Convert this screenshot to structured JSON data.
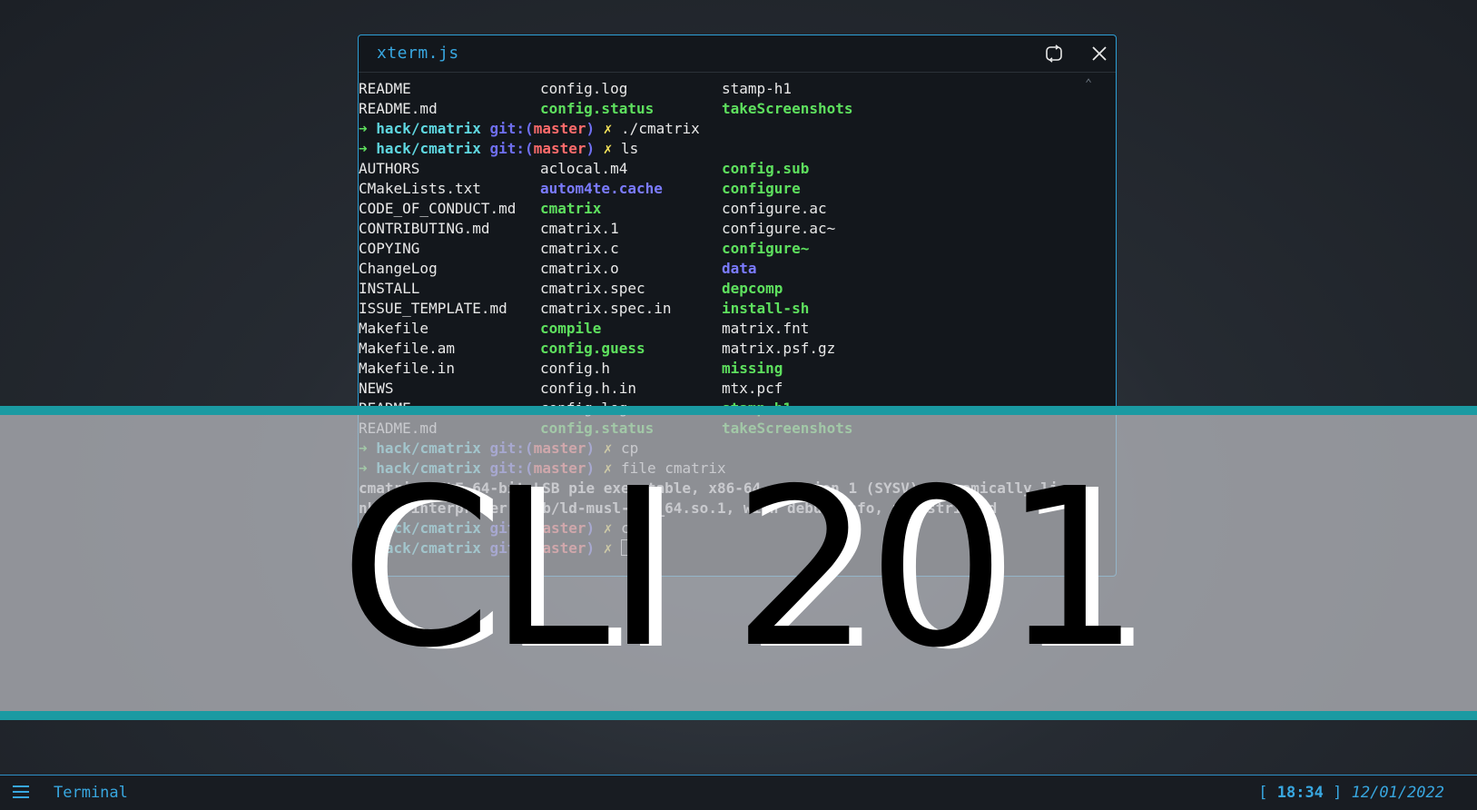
{
  "window": {
    "title": "xterm.js",
    "icons": {
      "refresh": "refresh-icon",
      "close": "close-icon",
      "scroll": "chevron-up-icon"
    },
    "scroll_glyph": "⌃"
  },
  "terminal": {
    "listing_top": [
      [
        {
          "t": "README",
          "s": ""
        },
        {
          "t": "config.log",
          "s": ""
        },
        {
          "t": "stamp-h1",
          "s": ""
        }
      ],
      [
        {
          "t": "README.md",
          "s": ""
        },
        {
          "t": "config.status",
          "s": "green"
        },
        {
          "t": "takeScreenshots",
          "s": "green"
        }
      ]
    ],
    "prompts_top": [
      {
        "arrow": "➜",
        "path": "hack/cmatrix",
        "git": "git:(",
        "branch": "master",
        "close": ")",
        "dirty": "✗",
        "cmd": "./cmatrix"
      },
      {
        "arrow": "➜",
        "path": "hack/cmatrix",
        "git": "git:(",
        "branch": "master",
        "close": ")",
        "dirty": "✗",
        "cmd": "ls"
      }
    ],
    "listing": [
      [
        {
          "t": "AUTHORS",
          "s": ""
        },
        {
          "t": "aclocal.m4",
          "s": ""
        },
        {
          "t": "config.sub",
          "s": "green"
        }
      ],
      [
        {
          "t": "CMakeLists.txt",
          "s": ""
        },
        {
          "t": "autom4te.cache",
          "s": "blue"
        },
        {
          "t": "configure",
          "s": "green"
        }
      ],
      [
        {
          "t": "CODE_OF_CONDUCT.md",
          "s": ""
        },
        {
          "t": "cmatrix",
          "s": "green"
        },
        {
          "t": "configure.ac",
          "s": ""
        }
      ],
      [
        {
          "t": "CONTRIBUTING.md",
          "s": ""
        },
        {
          "t": "cmatrix.1",
          "s": ""
        },
        {
          "t": "configure.ac~",
          "s": ""
        }
      ],
      [
        {
          "t": "COPYING",
          "s": ""
        },
        {
          "t": "cmatrix.c",
          "s": ""
        },
        {
          "t": "configure~",
          "s": "green"
        }
      ],
      [
        {
          "t": "ChangeLog",
          "s": ""
        },
        {
          "t": "cmatrix.o",
          "s": ""
        },
        {
          "t": "data",
          "s": "blue"
        }
      ],
      [
        {
          "t": "INSTALL",
          "s": ""
        },
        {
          "t": "cmatrix.spec",
          "s": ""
        },
        {
          "t": "depcomp",
          "s": "green"
        }
      ],
      [
        {
          "t": "ISSUE_TEMPLATE.md",
          "s": ""
        },
        {
          "t": "cmatrix.spec.in",
          "s": ""
        },
        {
          "t": "install-sh",
          "s": "green"
        }
      ],
      [
        {
          "t": "Makefile",
          "s": ""
        },
        {
          "t": "compile",
          "s": "green"
        },
        {
          "t": "matrix.fnt",
          "s": ""
        }
      ],
      [
        {
          "t": "Makefile.am",
          "s": ""
        },
        {
          "t": "config.guess",
          "s": "green"
        },
        {
          "t": "matrix.psf.gz",
          "s": ""
        }
      ],
      [
        {
          "t": "Makefile.in",
          "s": ""
        },
        {
          "t": "config.h",
          "s": ""
        },
        {
          "t": "missing",
          "s": "green"
        }
      ],
      [
        {
          "t": "NEWS",
          "s": ""
        },
        {
          "t": "config.h.in",
          "s": ""
        },
        {
          "t": "mtx.pcf",
          "s": ""
        }
      ],
      [
        {
          "t": "README",
          "s": ""
        },
        {
          "t": "config.log",
          "s": ""
        },
        {
          "t": "stamp-h1",
          "s": "green"
        }
      ],
      [
        {
          "t": "README.md",
          "s": ""
        },
        {
          "t": "config.status",
          "s": "green"
        },
        {
          "t": "takeScreenshots",
          "s": "green"
        }
      ]
    ],
    "prompts_mid": [
      {
        "arrow": "➜",
        "path": "hack/cmatrix",
        "git": "git:(",
        "branch": "master",
        "close": ")",
        "dirty": "✗",
        "cmd": "cp"
      },
      {
        "arrow": "➜",
        "path": "hack/cmatrix",
        "git": "git:(",
        "branch": "master",
        "close": ")",
        "dirty": "✗",
        "cmd": "file cmatrix"
      }
    ],
    "output_lines": [
      "cmatrix: ELF 64-bit LSB pie executable, x86-64, version 1 (SYSV), dynamically li",
      "nked, interpreter /lib/ld-musl-x86_64.so.1, with debug_info, not stripped"
    ],
    "prompts_bottom": [
      {
        "arrow": "➜",
        "path": "hack/cmatrix",
        "git": "git:(",
        "branch": "master",
        "close": ")",
        "dirty": "✗",
        "cmd": "cp"
      },
      {
        "arrow": "➜",
        "path": "hack/cmatrix",
        "git": "git:(",
        "branch": "master",
        "close": ")",
        "dirty": "✗",
        "cmd": ""
      }
    ]
  },
  "banner": {
    "title": "CLI 201"
  },
  "statusbar": {
    "menu_icon": "hamburger-menu-icon",
    "label": "Terminal",
    "clock_open": "[ ",
    "time": "18:34",
    "clock_close": " ] ",
    "date": "12/01/2022"
  },
  "colors": {
    "accent": "#38a7e0",
    "banner_stripe": "#1a9aa2",
    "ls_executable": "#5ee05e",
    "ls_directory": "#7b7bff",
    "prompt_path": "#5fd7e0",
    "prompt_branch": "#ff6b6b",
    "prompt_dirty": "#f3e15a"
  }
}
